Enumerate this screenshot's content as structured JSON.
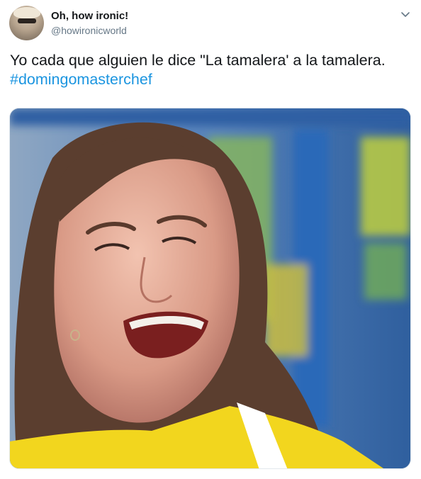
{
  "author": {
    "display_name": "Oh, how ironic!",
    "handle": "@howironicworld"
  },
  "tweet": {
    "text": "Yo cada que alguien le dice \"La tamalera' a la tamalera.",
    "hashtag": "#domingomasterchef"
  },
  "icons": {
    "menu": "chevron-down-icon"
  },
  "colors": {
    "link": "#1b95e0",
    "secondary_text": "#657786",
    "primary_text": "#14171a",
    "photo_background": "#3f74b8",
    "shirt": "#f4dc1e"
  }
}
